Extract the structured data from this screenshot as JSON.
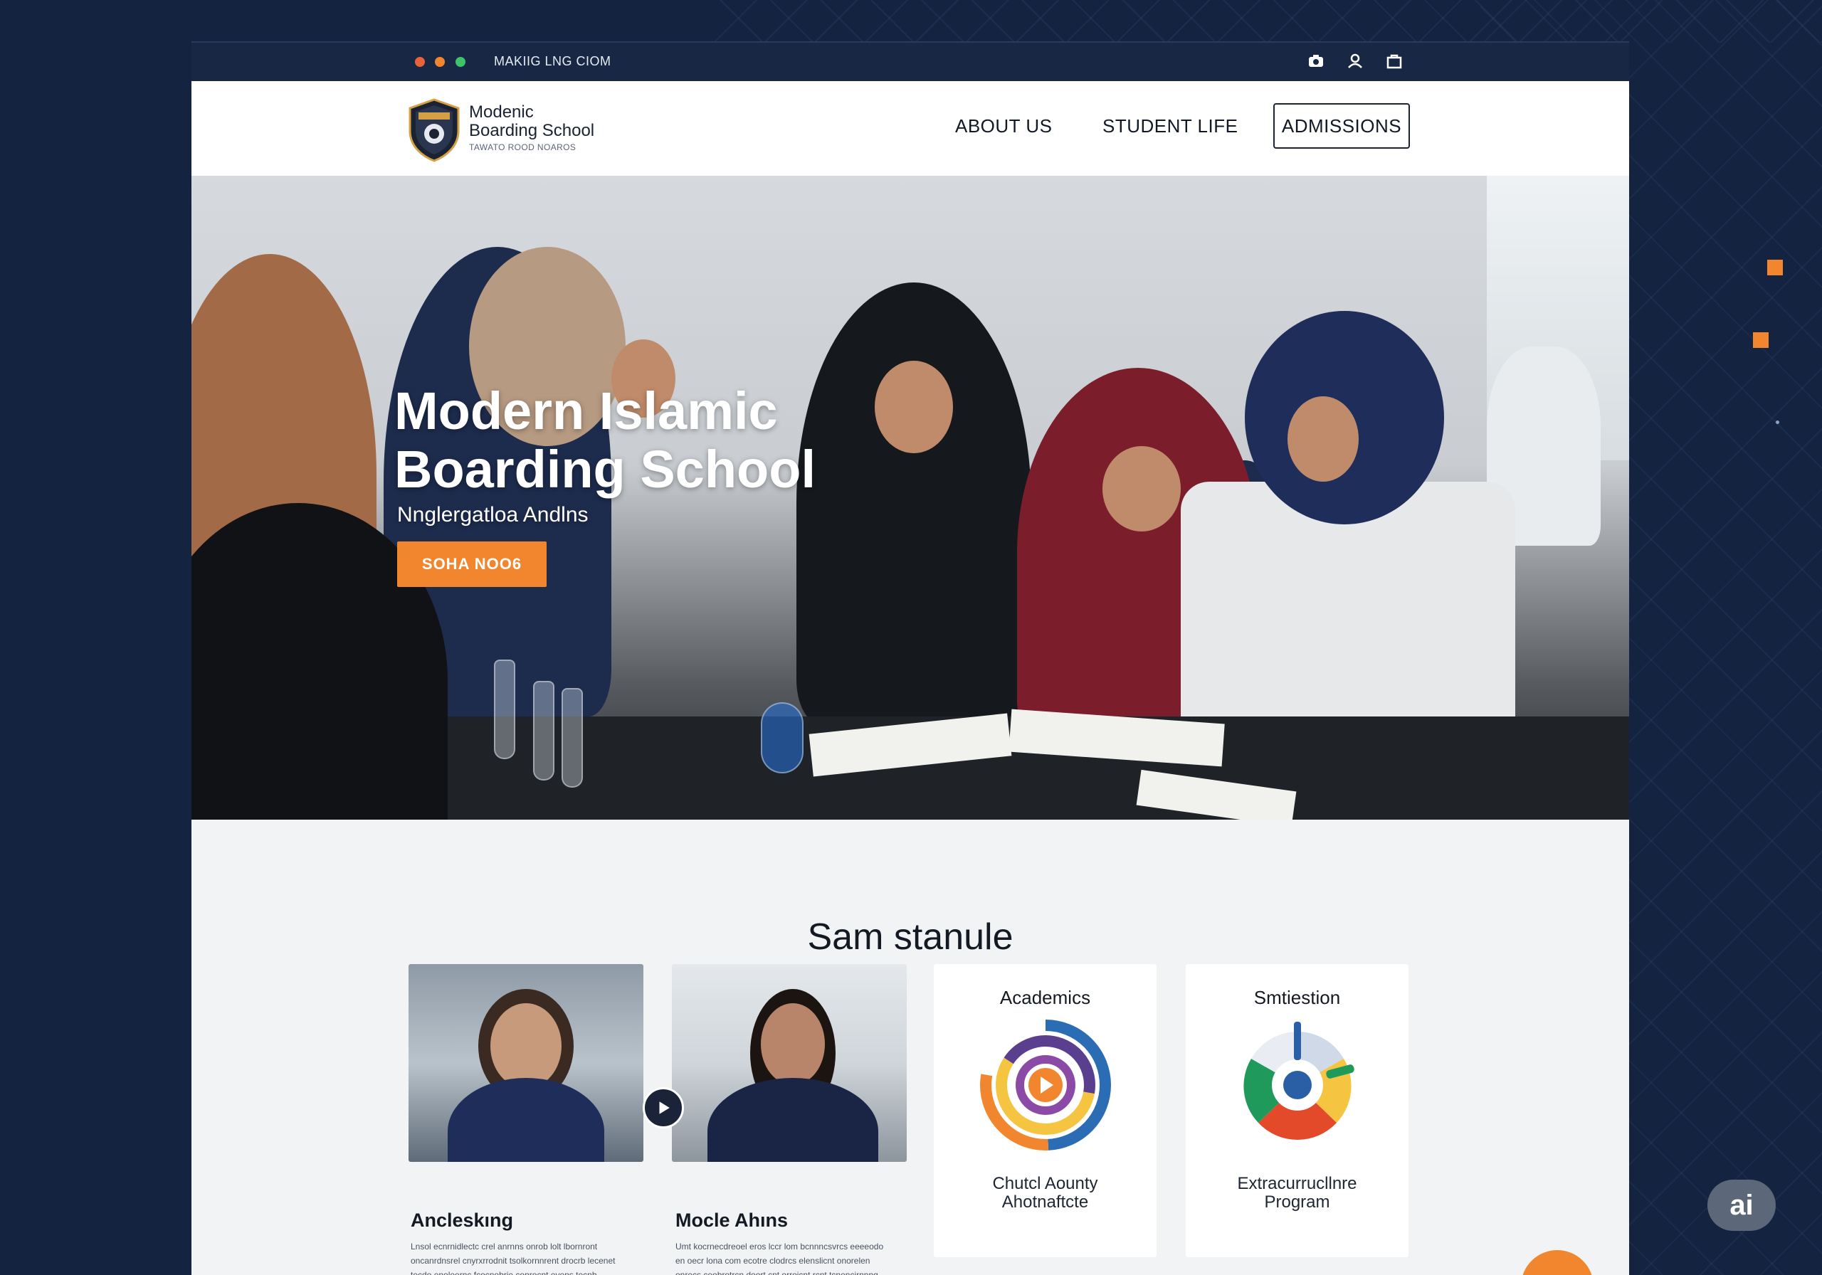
{
  "browser": {
    "url": "MAKIIG LNG CIOM",
    "icons": [
      "camera-icon",
      "user-icon",
      "bag-icon"
    ]
  },
  "header": {
    "logo_line1": "Modenic",
    "logo_line2": "Boarding School",
    "logo_tagline": "TAWATO ROOD NOAROS",
    "nav": {
      "about": "ABOUT US",
      "student_life": "STUDENT LIFE",
      "admissions": "ADMISSIONS"
    }
  },
  "hero": {
    "title_line1": "Modern Islamic",
    "title_line2": "Boarding School",
    "subtitle": "Nnglergatloa Andlns",
    "cta": "SOHA NOO6"
  },
  "section": {
    "title": "Sam stanule",
    "cards": [
      {
        "title": "Ancleskıng",
        "text": "Lnsol ecnrnidlectc crel anrnns onrob lolt lbornront oncanrdnsrel cnyrxrrodnit tsolkornnrent drocrb lecenet tecdo enoleernc fcocnobrie conrocnt evens tecnb omonioptre."
      },
      {
        "title": "Mocle Ahıns",
        "text": "Umt kocrnecdreoel eros lccr lom bcnnncsvrcs eeeeodo en oecr lona com ecotre clodrcs elenslicnt onorelen onrecs ceobrotrcn doort cnt orroicnt rcnt tcnencirnnng eitsto orts-orctr."
      },
      {
        "title": "Academics",
        "caption_line1": "Chutcl Aounty",
        "caption_line2": "Ahotnaftcte"
      },
      {
        "title": "Smtiestion",
        "caption_line1": "Extracurrucllnre",
        "caption_line2": "Program"
      }
    ]
  },
  "badge": "ai",
  "colors": {
    "accent": "#f2862e",
    "navy": "#182844",
    "page_bg": "#142440"
  }
}
